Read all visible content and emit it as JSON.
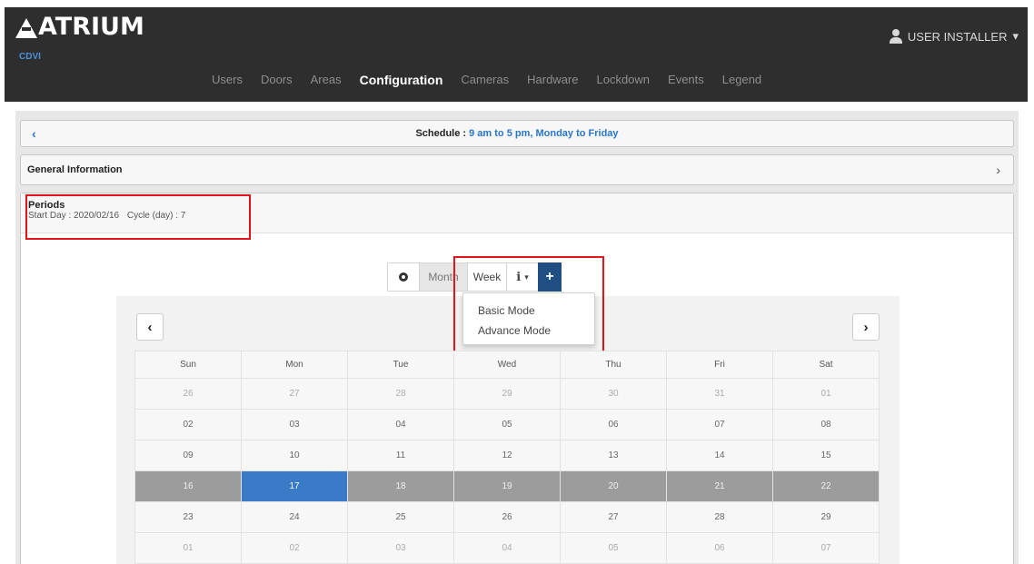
{
  "header": {
    "logo_text": "ATRIUM",
    "brand_sub": "CDVI",
    "user_label": "USER INSTALLER",
    "user_caret": "▾",
    "nav": [
      {
        "label": "Users",
        "active": false
      },
      {
        "label": "Doors",
        "active": false
      },
      {
        "label": "Areas",
        "active": false
      },
      {
        "label": "Configuration",
        "active": true
      },
      {
        "label": "Cameras",
        "active": false
      },
      {
        "label": "Hardware",
        "active": false
      },
      {
        "label": "Lockdown",
        "active": false
      },
      {
        "label": "Events",
        "active": false
      },
      {
        "label": "Legend",
        "active": false
      }
    ]
  },
  "schedule": {
    "back_icon": "‹",
    "title_prefix": "Schedule : ",
    "title_value": "9 am to 5 pm, Monday to Friday"
  },
  "general": {
    "label": "General Information",
    "chevron": "›"
  },
  "periods": {
    "title": "Periods",
    "start_day": "Start Day : 2020/02/16",
    "cycle": "Cycle (day) : 7"
  },
  "toolbar": {
    "month": "Month",
    "week": "Week",
    "info_caret": "▾",
    "plus": "+"
  },
  "dropdown": {
    "items": [
      "Basic Mode",
      "Advance Mode"
    ]
  },
  "calendar": {
    "prev": "‹",
    "next": "›",
    "weekdays": [
      "Sun",
      "Mon",
      "Tue",
      "Wed",
      "Thu",
      "Fri",
      "Sat"
    ],
    "weeks": [
      [
        "26",
        "27",
        "28",
        "29",
        "30",
        "31",
        "01"
      ],
      [
        "02",
        "03",
        "04",
        "05",
        "06",
        "07",
        "08"
      ],
      [
        "09",
        "10",
        "11",
        "12",
        "13",
        "14",
        "15"
      ],
      [
        "16",
        "17",
        "18",
        "19",
        "20",
        "21",
        "22"
      ],
      [
        "23",
        "24",
        "25",
        "26",
        "27",
        "28",
        "29"
      ],
      [
        "01",
        "02",
        "03",
        "04",
        "05",
        "06",
        "07"
      ]
    ],
    "selected_week_index": 3,
    "today_day_index": 1,
    "muted_weeks": [
      0,
      5
    ]
  },
  "colors": {
    "accent": "#2a76c9",
    "primary_button": "#1f4e85",
    "highlight": "#e3141b",
    "selected_row": "#9c9c9c"
  }
}
